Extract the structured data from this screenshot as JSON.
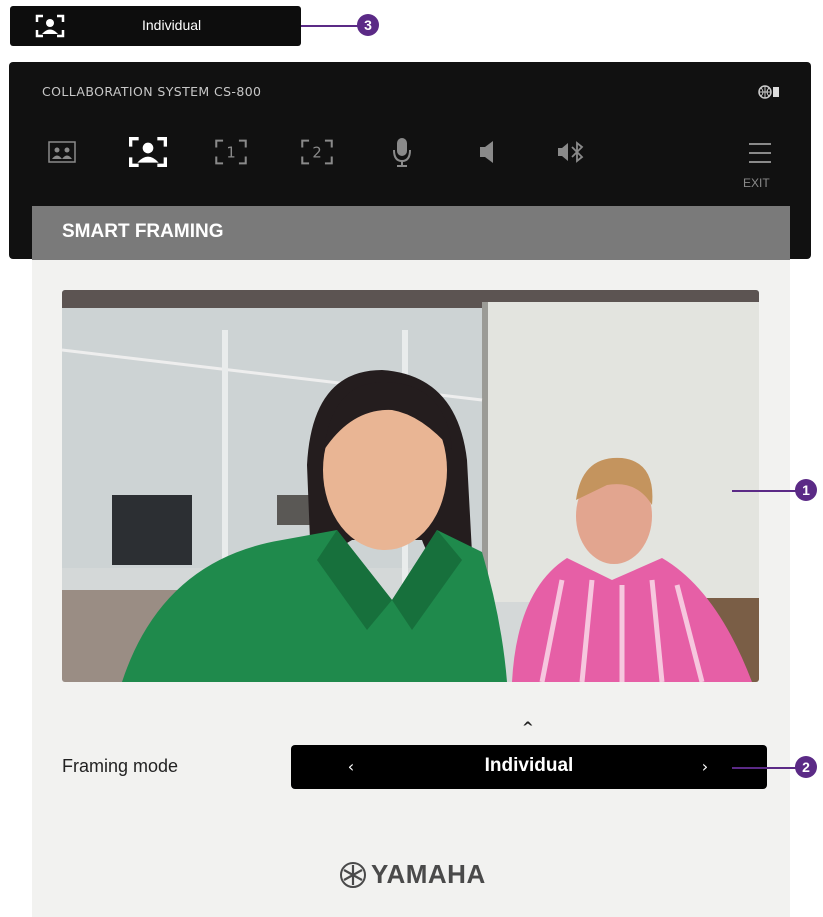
{
  "top_indicator": {
    "icon": "individual-framing-icon",
    "label": "Individual"
  },
  "callouts": [
    "1",
    "2",
    "3"
  ],
  "panel": {
    "system_title": "COLLABORATION SYSTEM CS-800",
    "status_icon": "network-status-icon",
    "tabs": [
      {
        "name": "group-framing",
        "icon": "group-framing-icon",
        "active": false
      },
      {
        "name": "individual-framing",
        "icon": "individual-framing-icon",
        "active": true
      },
      {
        "name": "area-1",
        "icon": "area-1-icon",
        "label": "1",
        "active": false
      },
      {
        "name": "area-2",
        "icon": "area-2-icon",
        "label": "2",
        "active": false
      },
      {
        "name": "microphone",
        "icon": "microphone-icon",
        "active": false
      },
      {
        "name": "speaker",
        "icon": "speaker-icon",
        "active": false
      },
      {
        "name": "bluetooth-speaker",
        "icon": "bluetooth-speaker-icon",
        "active": false
      }
    ],
    "exit_label": "EXIT"
  },
  "section": {
    "title": "SMART FRAMING"
  },
  "framing": {
    "label": "Framing mode",
    "value": "Individual",
    "prev": "‹",
    "next": "›",
    "up": "^"
  },
  "brand": {
    "name": "YAMAHA",
    "icon": "yamaha-tuning-fork-icon"
  },
  "colors": {
    "callout": "#5b2a86",
    "panel_bg": "#111111",
    "header_bg": "#7a7a7a",
    "content_bg": "#f2f2f0"
  }
}
